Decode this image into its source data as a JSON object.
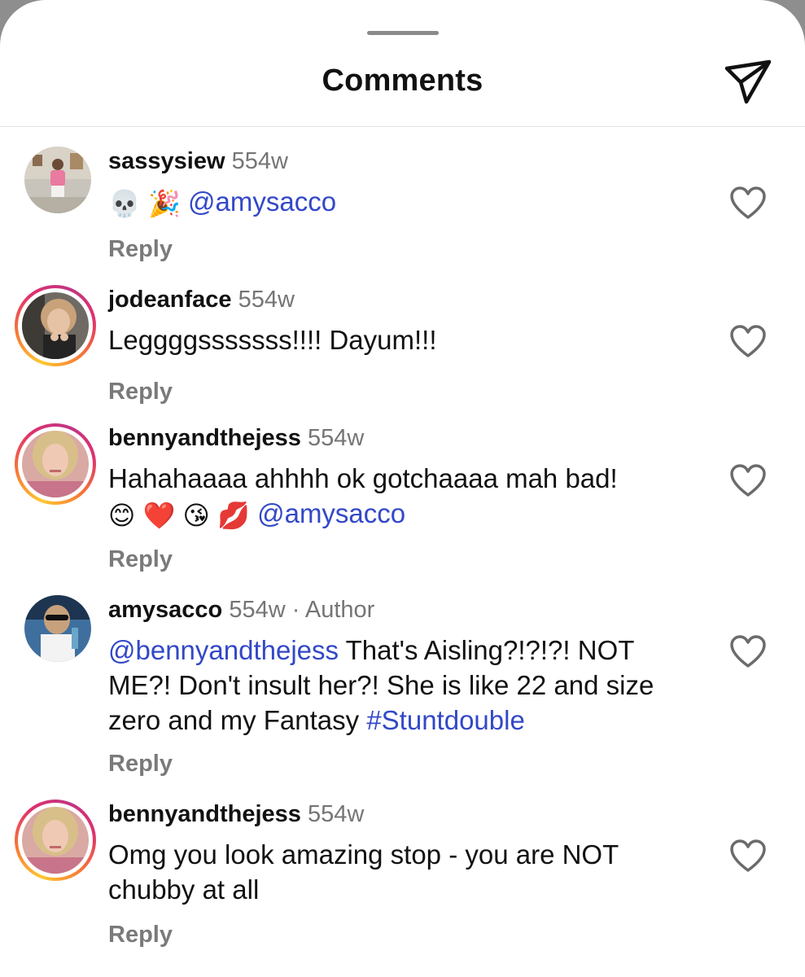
{
  "header": {
    "title": "Comments",
    "share_icon": "send-icon"
  },
  "colors": {
    "mention": "#3348c7",
    "meta": "#757575",
    "ring_start": "#fdc830",
    "ring_end": "#c13584"
  },
  "comments": [
    {
      "username": "sassysiew",
      "time": "554w",
      "emojis": [
        "💀",
        "🎉"
      ],
      "mention": "@amysacco",
      "reply": "Reply"
    },
    {
      "username": "jodeanface",
      "time": "554w",
      "text": "Leggggsssssss!!!! Dayum!!!",
      "reply": "Reply"
    },
    {
      "username": "bennyandthejess",
      "time": "554w",
      "text": "Hahahaaaa ahhhh ok gotchaaaa mah bad!",
      "emojis": [
        "😊",
        "❤️",
        "😘",
        "💋"
      ],
      "mention": "@amysacco",
      "reply": "Reply"
    },
    {
      "username": "amysacco",
      "time": "554w",
      "badge": "· Author",
      "mention": "@bennyandthejess",
      "text": "That's Aisling?!?!?! NOT ME?! Don't insult her?! She is like 22 and size zero and my Fantasy",
      "hashtag": "#Stuntdouble",
      "reply": "Reply"
    },
    {
      "username": "bennyandthejess",
      "time": "554w",
      "text": "Omg you look amazing stop - you are NOT chubby at all",
      "reply": "Reply"
    }
  ]
}
